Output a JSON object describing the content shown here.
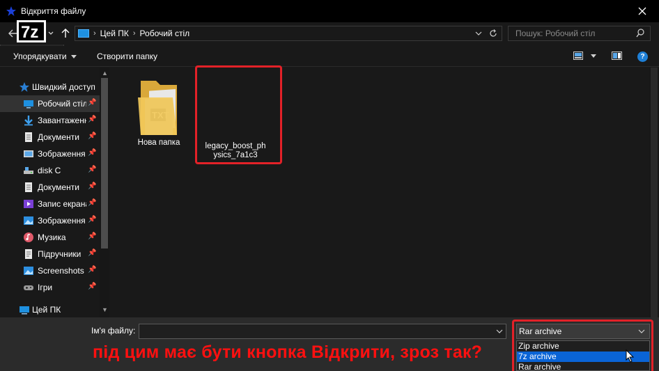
{
  "window": {
    "title": "Відкриття файлу",
    "close_glyph": "✕"
  },
  "address": {
    "crumbs": [
      "Цей ПК",
      "Робочий стіл"
    ]
  },
  "search": {
    "placeholder": "Пошук: Робочий стіл"
  },
  "toolbar": {
    "organize_label": "Упорядкувати",
    "new_folder_label": "Створити папку",
    "help_label": "?"
  },
  "sidebar": {
    "quick_access": "Швидкий доступ",
    "items": [
      {
        "label": "Робочий стіл",
        "icon": "desktop-icon",
        "pinned": true,
        "selected": true
      },
      {
        "label": "Завантаження",
        "icon": "download-icon",
        "pinned": true
      },
      {
        "label": "Документи",
        "icon": "documents-icon",
        "pinned": true
      },
      {
        "label": "Зображення",
        "icon": "pictures-icon",
        "pinned": true
      },
      {
        "label": "disk C",
        "icon": "drive-icon",
        "pinned": true
      },
      {
        "label": "Документи",
        "icon": "documents-icon",
        "pinned": true
      },
      {
        "label": "Запис екрана",
        "icon": "video-icon",
        "pinned": true
      },
      {
        "label": "Зображення",
        "icon": "pictures-icon",
        "pinned": true
      },
      {
        "label": "Музика",
        "icon": "music-icon",
        "pinned": true
      },
      {
        "label": "Підручники",
        "icon": "folder-doc-icon",
        "pinned": true
      },
      {
        "label": "Screenshots",
        "icon": "pictures-icon",
        "pinned": true
      },
      {
        "label": "Ігри",
        "icon": "gamepad-icon",
        "pinned": true
      }
    ],
    "this_pc": "Цей ПК"
  },
  "files": [
    {
      "name": "Нова папка",
      "icon": "folder-icon"
    },
    {
      "name_line1": "legacy_boost_ph",
      "name_line2": "ysics_7a1c3",
      "icon": "7z-archive-icon",
      "badge": "7z"
    }
  ],
  "bottom": {
    "filename_label": "Ім'я файлу:",
    "filename_value": "",
    "file_type_selected": "Rar archive",
    "file_type_options": [
      "Zip archive",
      "7z archive",
      "Rar archive"
    ],
    "highlighted_option": "7z archive"
  },
  "annotation": "під цим має бути кнопка Відкрити, зроз так?",
  "colors": {
    "highlight": "#e32128",
    "annotation": "#ff1010",
    "selection": "#0a64d6"
  }
}
